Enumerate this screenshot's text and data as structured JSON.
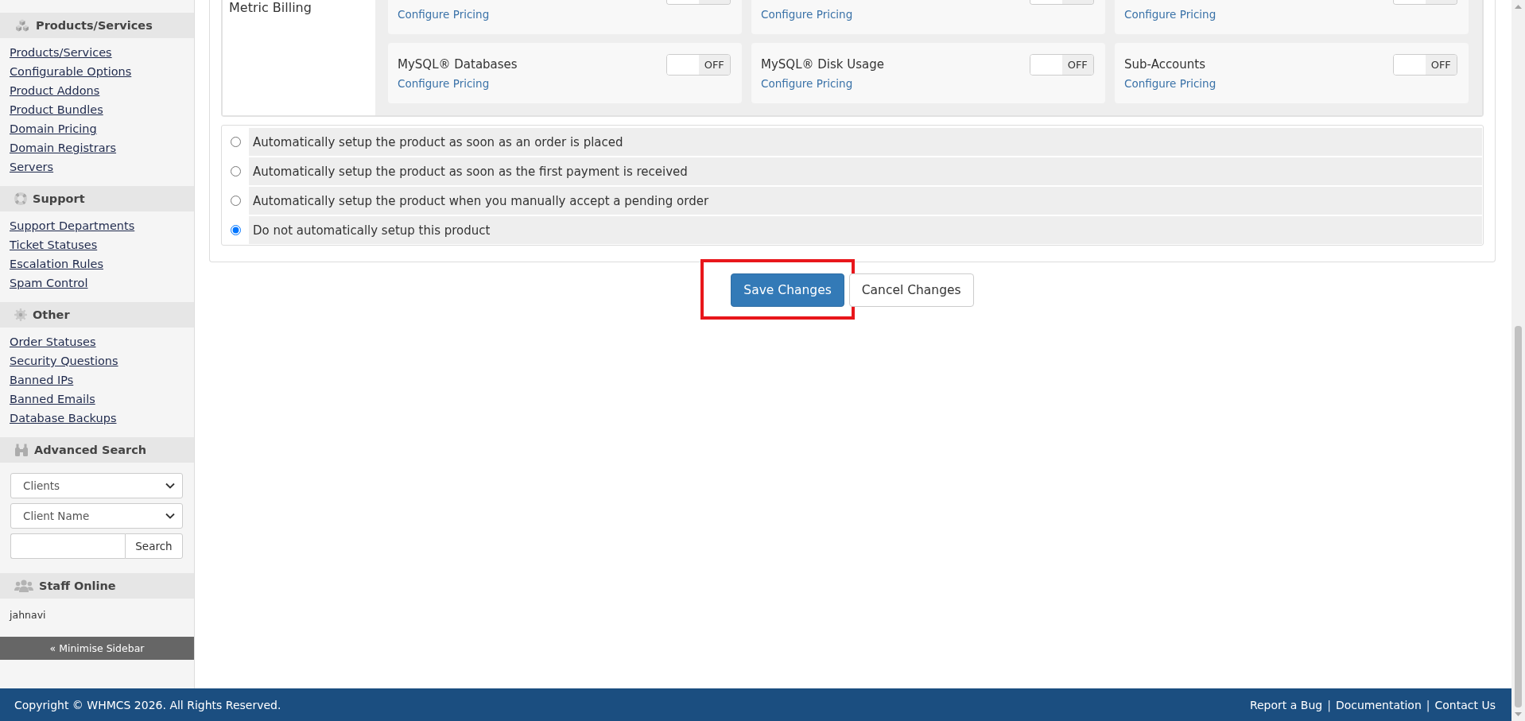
{
  "sidebar": {
    "sections": [
      {
        "kind": "links",
        "title": "Products/Services",
        "links": [
          "Products/Services",
          "Configurable Options",
          "Product Addons",
          "Product Bundles",
          "Domain Pricing",
          "Domain Registrars",
          "Servers"
        ]
      },
      {
        "kind": "links",
        "title": "Support",
        "links": [
          "Support Departments",
          "Ticket Statuses",
          "Escalation Rules",
          "Spam Control"
        ]
      },
      {
        "kind": "links",
        "title": "Other",
        "links": [
          "Order Statuses",
          "Security Questions",
          "Banned IPs",
          "Banned Emails",
          "Database Backups"
        ]
      },
      {
        "kind": "search",
        "title": "Advanced Search",
        "selects": [
          "Clients",
          "Client Name"
        ],
        "button": "Search"
      },
      {
        "kind": "staff",
        "title": "Staff Online",
        "staff": [
          "jahnavi"
        ]
      }
    ],
    "minimise_button": "« Minimise Sidebar"
  },
  "metric_billing": {
    "label": "Metric Billing",
    "metrics": [
      {
        "link": "Configure Pricing",
        "on": false
      },
      {
        "link": "Configure Pricing",
        "on": false
      },
      {
        "link": "Configure Pricing",
        "on": false
      },
      {
        "name": "MySQL® Databases",
        "link": "Configure Pricing",
        "on": false,
        "toggle_label": "OFF"
      },
      {
        "name": "MySQL® Disk Usage",
        "link": "Configure Pricing",
        "on": false,
        "toggle_label": "OFF"
      },
      {
        "name": "Sub-Accounts",
        "link": "Configure Pricing",
        "on": false,
        "toggle_label": "OFF"
      }
    ]
  },
  "setup_options": [
    {
      "label": "Automatically setup the product as soon as an order is placed",
      "selected": false
    },
    {
      "label": "Automatically setup the product as soon as the first payment is received",
      "selected": false
    },
    {
      "label": "Automatically setup the product when you manually accept a pending order",
      "selected": false
    },
    {
      "label": "Do not automatically setup this product",
      "selected": true
    }
  ],
  "buttons": [
    {
      "label": "Save Changes",
      "kind": "primary",
      "highlighted": true
    },
    {
      "label": "Cancel Changes",
      "kind": "default",
      "highlighted": false
    }
  ],
  "footer": {
    "copyright": "Copyright © WHMCS 2026. All Rights Reserved.",
    "links": [
      {
        "kind": "link",
        "text": "Report a Bug"
      },
      {
        "kind": "separator",
        "text": "|"
      },
      {
        "kind": "link",
        "text": "Documentation"
      },
      {
        "kind": "separator",
        "text": "|"
      },
      {
        "kind": "link",
        "text": "Contact Us"
      }
    ]
  }
}
